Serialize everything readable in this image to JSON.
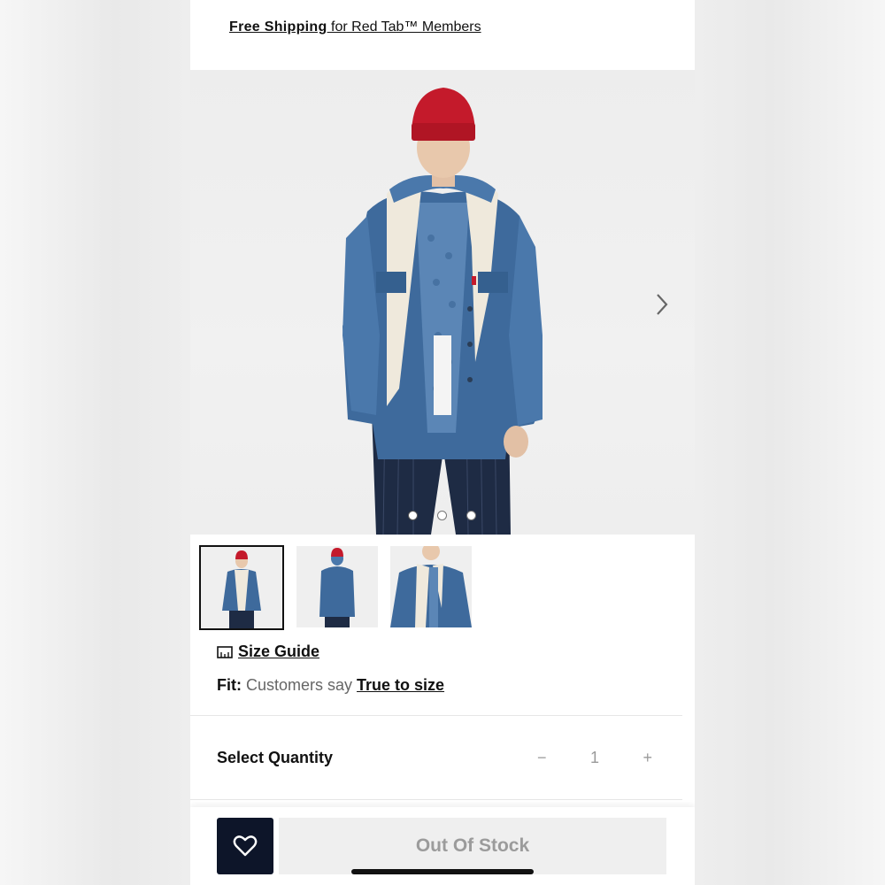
{
  "promo": {
    "bold": "Free Shipping",
    "rest": " for Red Tab™ Members"
  },
  "hero": {
    "image_label": "model-in-denim-sherpa-jacket",
    "dots_count": 3,
    "active_dot": 1
  },
  "thumbnails": [
    {
      "label": "front-view",
      "selected": true
    },
    {
      "label": "back-view",
      "selected": false
    },
    {
      "label": "closeup-view",
      "selected": false
    }
  ],
  "size_guide": {
    "label": "Size Guide",
    "icon": "ruler-icon"
  },
  "fit": {
    "key": "Fit:",
    "say": " Customers say ",
    "link": "True to size"
  },
  "quantity": {
    "label": "Select Quantity",
    "minus": "−",
    "value": "1",
    "plus": "+"
  },
  "footer": {
    "wishlist_icon": "heart-icon",
    "status": "Out Of Stock"
  },
  "colors": {
    "wishlist_bg": "#0d1529",
    "disabled_text": "#9b9b9b",
    "beanie": "#c41a2b",
    "denim": "#3e6a9c"
  }
}
